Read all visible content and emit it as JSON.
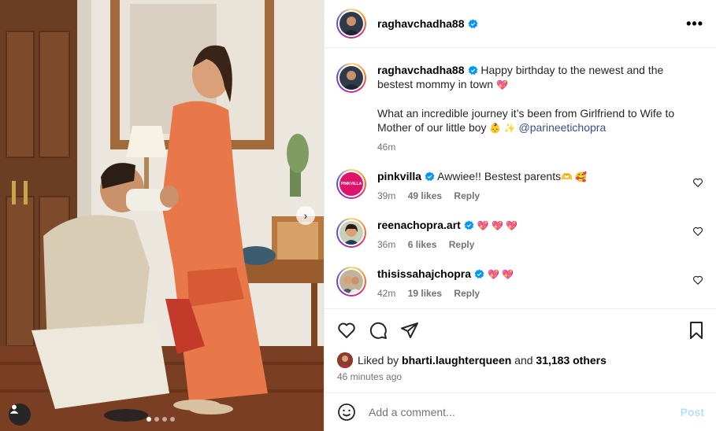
{
  "post": {
    "username": "raghavchadha88",
    "more_icon": "more-horizontal-icon",
    "caption_line1": "Happy birthday to the newest and the bestest mommy in town",
    "caption_line1_emoji": "💖",
    "caption_line2": "What an incredible journey it’s been from Girlfriend to Wife to Mother of our little boy",
    "caption_line2_emoji": "👶 ✨",
    "caption_mention": "@parineetichopra",
    "caption_time": "46m"
  },
  "comments": [
    {
      "username": "pinkvilla",
      "avatar_text": "PINKVILLA",
      "text": "Awwiee!! Bestest parents",
      "emoji": "🫶 🥰",
      "time": "39m",
      "likes": "49 likes",
      "reply": "Reply"
    },
    {
      "username": "reenachopra.art",
      "text": "",
      "emoji": "💖 💖 💖",
      "time": "36m",
      "likes": "6 likes",
      "reply": "Reply"
    },
    {
      "username": "thisissahajchopra",
      "text": "",
      "emoji": "💖 💖",
      "time": "42m",
      "likes": "19 likes",
      "reply": "Reply"
    }
  ],
  "likes": {
    "prefix": "Liked by",
    "user": "bharti.laughterqueen",
    "and": "and",
    "others": "31,183 others"
  },
  "timestamp": "46 minutes ago",
  "add_comment": {
    "placeholder": "Add a comment...",
    "post_label": "Post"
  },
  "carousel": {
    "slides": 4,
    "active": 1
  },
  "colors": {
    "accent": "#0095f6",
    "post_disabled": "#b2dffc",
    "verified": "#0095f6",
    "heart_red": "#ed1b4c"
  }
}
